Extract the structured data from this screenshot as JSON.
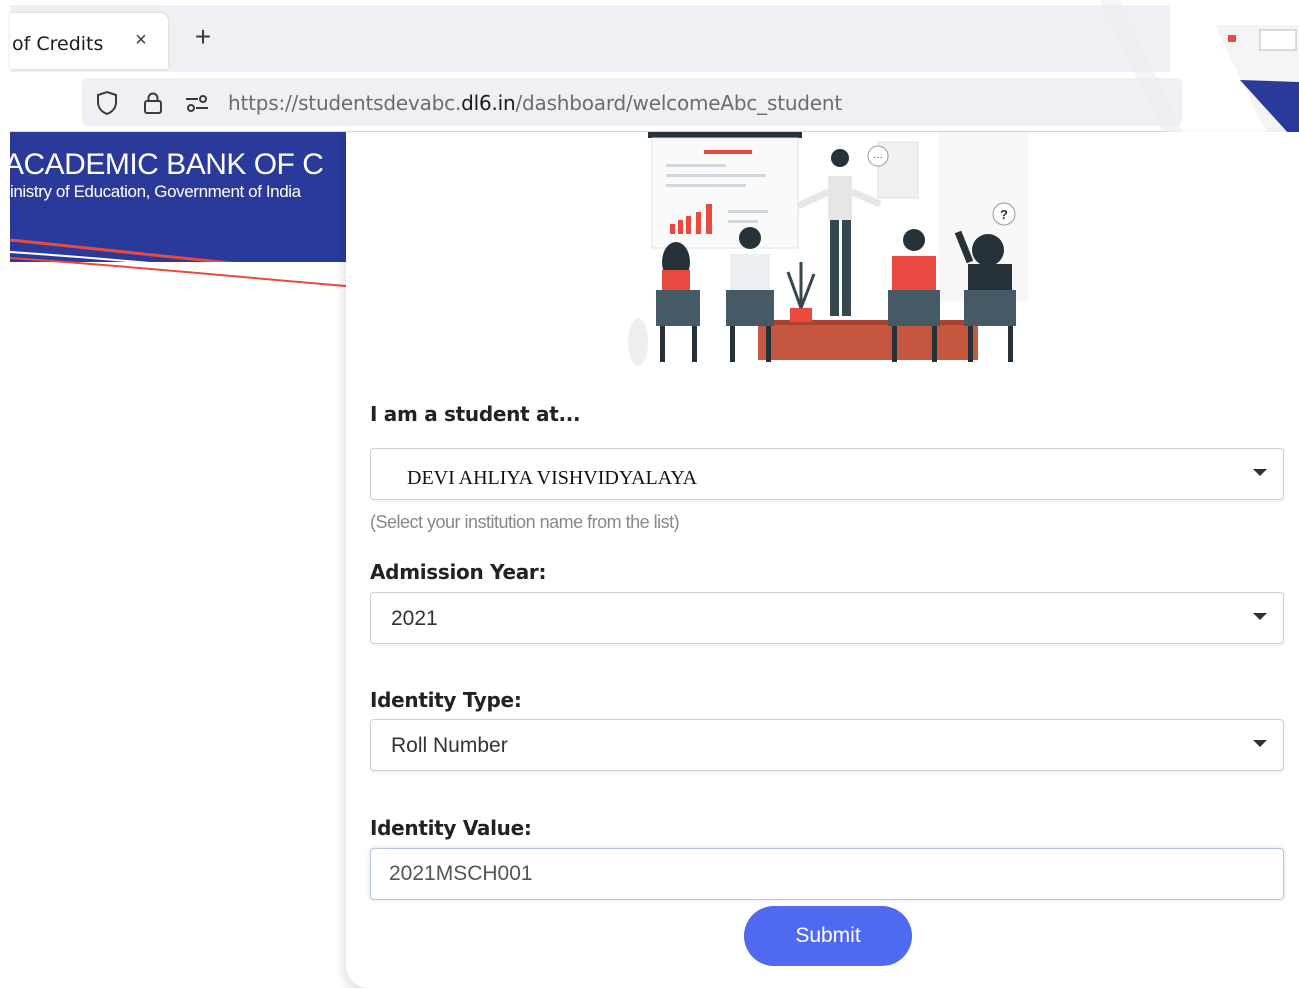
{
  "browser": {
    "tab_title": "of Credits",
    "tab_close": "×",
    "new_tab": "+",
    "url_prefix": "https://studentsdevabc.",
    "url_domain": "dl6.in",
    "url_path": "/dashboard/welcomeAbc_student"
  },
  "banner": {
    "title": "ACADEMIC BANK OF C",
    "subtitle": "inistry of Education, Government of India"
  },
  "form": {
    "institution_label": "I am a student at...",
    "institution_value": "DEVI AHLIYA VISHVIDYALAYA",
    "institution_hint": "(Select your institution name from the list)",
    "year_label": "Admission Year:",
    "year_value": "2021",
    "identity_type_label": "Identity Type:",
    "identity_type_value": "Roll Number",
    "identity_value_label": "Identity Value:",
    "identity_value": "2021MSCH001",
    "submit_label": "Submit"
  },
  "colors": {
    "banner_blue": "#2a3a9b",
    "accent_red": "#e84a3f",
    "submit_blue": "#4f6af0"
  }
}
